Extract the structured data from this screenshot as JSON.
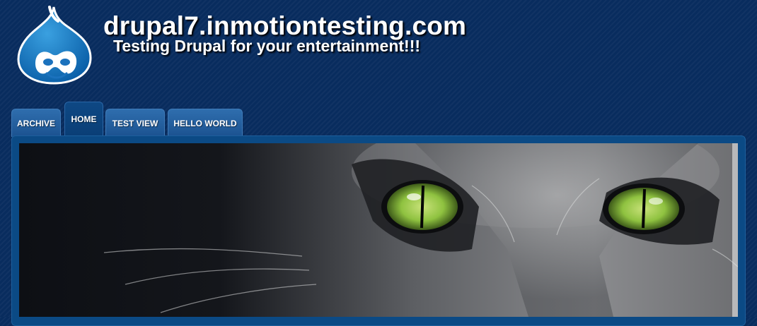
{
  "header": {
    "site_name": "drupal7.inmotiontesting.com",
    "slogan": "Testing Drupal for your entertainment!!!"
  },
  "nav": {
    "tabs": [
      {
        "label": "ARCHIVE",
        "active": false
      },
      {
        "label": "HOME",
        "active": true
      },
      {
        "label": "TEST VIEW",
        "active": false
      },
      {
        "label": "HELLO WORLD",
        "active": false
      }
    ]
  },
  "colors": {
    "background": "#082c5e",
    "tab": "#1f5a9a",
    "tab_active": "#0d4682",
    "panel": "#0b4a85",
    "eye": "#8fc240"
  },
  "icons": {
    "logo": "drupal-drop-icon"
  }
}
